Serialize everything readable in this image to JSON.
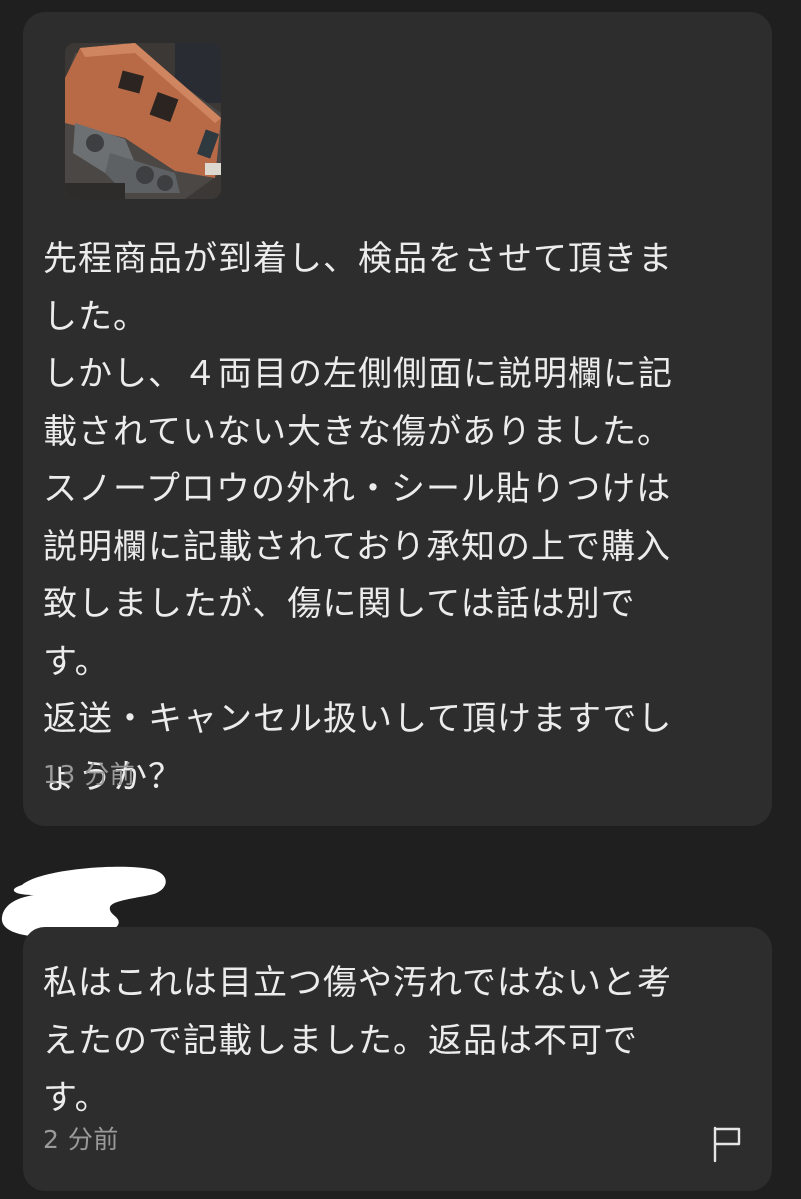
{
  "messages": [
    {
      "attachment_icon": "photo-thumbnail",
      "lines": [
        "先程商品が到着し、検品をさせて頂きま",
        "した。",
        "しかし、４両目の左側側面に説明欄に記",
        "載されていない大きな傷がありました。",
        "スノープロウの外れ・シール貼りつけは",
        "説明欄に記載されており承知の上で購入",
        "致しましたが、傷に関しては話は別で",
        "す。",
        "返送・キャンセル扱いして頂けますでし",
        "ょうか？"
      ],
      "time": "13 分前"
    },
    {
      "lines": [
        "私はこれは目立つ傷や汚れではないと考",
        "えたので記載しました。返品は不可で",
        "す。"
      ],
      "time": "2 分前",
      "action_icon": "flag-icon"
    }
  ],
  "colors": {
    "background": "#1f1f1f",
    "bubble": "#2d2d2d",
    "text": "#ececec",
    "timestamp": "#9a9a9a"
  }
}
